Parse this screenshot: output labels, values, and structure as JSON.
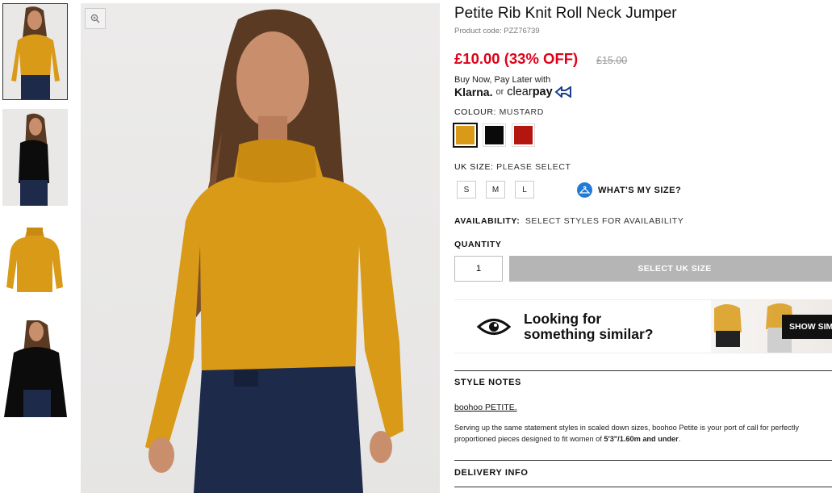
{
  "product": {
    "title": "Petite Rib Knit Roll Neck Jumper",
    "code": "Product code: PZZ76739",
    "price": "£10.00 (33% OFF)",
    "was_price": "£15.00"
  },
  "payment": {
    "pay_later_text": "Buy Now, Pay Later with",
    "klarna": "Klarna.",
    "or": "or",
    "clearpay_a": "clear",
    "clearpay_b": "pay"
  },
  "colour": {
    "label": "COLOUR:",
    "value": "MUSTARD",
    "swatches": [
      {
        "name": "Mustard",
        "hex": "#d99a17",
        "selected": true
      },
      {
        "name": "Black",
        "hex": "#0a0a0a",
        "selected": false
      },
      {
        "name": "Red",
        "hex": "#b3150f",
        "selected": false
      }
    ]
  },
  "size": {
    "label": "UK SIZE:",
    "value": "PLEASE SELECT",
    "options": [
      "S",
      "M",
      "L"
    ],
    "whats_my_size": "WHAT'S MY SIZE?"
  },
  "availability": {
    "label": "AVAILABILITY:",
    "value": "SELECT STYLES FOR AVAILABILITY"
  },
  "quantity": {
    "label": "QUANTITY",
    "value": "1"
  },
  "cta_label": "SELECT UK SIZE",
  "similar": {
    "line1": "Looking for",
    "line2": "something similar?",
    "button": "SHOW SIM"
  },
  "style_notes": {
    "heading": "STYLE NOTES",
    "brand": "boohoo PETITE.",
    "description_a": "Serving up the same statement styles in scaled down sizes, boohoo Petite is your port of call for perfectly proportioned pieces designed to fit women of ",
    "description_b": "5'3\"/1.60m and under",
    "description_c": "."
  },
  "delivery_heading": "DELIVERY INFO",
  "colors": {
    "sale_red": "#e00019",
    "mustard": "#d99a17",
    "cta_grey": "#b5b5b5",
    "accent_blue": "#1f7ad8"
  }
}
